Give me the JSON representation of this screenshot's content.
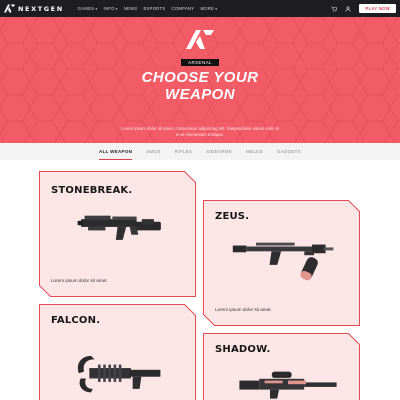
{
  "nav": {
    "brand": "NEXTGEN",
    "menu": [
      {
        "label": "GAMES",
        "has_caret": true
      },
      {
        "label": "INFO",
        "has_caret": true
      },
      {
        "label": "NEWS",
        "has_caret": false
      },
      {
        "label": "ESPORTS",
        "has_caret": false
      },
      {
        "label": "COMPANY",
        "has_caret": false
      },
      {
        "label": "MORE",
        "has_caret": true
      }
    ],
    "icons": [
      "cart-icon",
      "user-icon"
    ],
    "cta": "PLAY NOW",
    "colors": {
      "bar": "#1e1e22",
      "accent": "#e0404a"
    }
  },
  "hero": {
    "badge": "ARSENAL",
    "title_line1": "CHOOSE YOUR",
    "title_line2": "WEAPON",
    "subtitle": "Lorem ipsum dolor sit amet, consectetur adipiscing elit. Suspendisse varius enim in eros elementum tristique.",
    "bg_color": "#f25c66"
  },
  "tabs": [
    {
      "label": "ALL WEAPON",
      "active": true
    },
    {
      "label": "SMGS",
      "active": false
    },
    {
      "label": "RIFLES",
      "active": false
    },
    {
      "label": "SIDEARMS",
      "active": false
    },
    {
      "label": "MELEE",
      "active": false
    },
    {
      "label": "GADGETS",
      "active": false
    }
  ],
  "cards": [
    {
      "title": "STONEBREAK.",
      "desc": "Lorem ipsum dolor sit amet.",
      "weapon_icon": "launcher-weapon"
    },
    {
      "title": "ZEUS.",
      "desc": "Lorem ipsum dolor sit amet.",
      "weapon_icon": "crossbow-weapon"
    },
    {
      "title": "FALCON.",
      "desc": "",
      "weapon_icon": "claw-weapon"
    },
    {
      "title": "SHADOW.",
      "desc": "",
      "weapon_icon": "sniper-weapon"
    }
  ]
}
